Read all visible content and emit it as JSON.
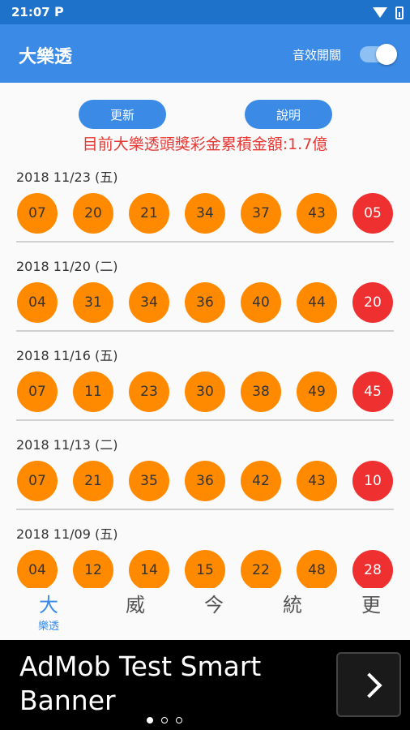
{
  "status_bar": {
    "time": "21:07",
    "notification_icon": "P"
  },
  "app_bar": {
    "title": "大樂透",
    "sound_label": "音效開關",
    "sound_on": true
  },
  "buttons": {
    "update": "更新",
    "help": "說明"
  },
  "jackpot_text": "目前大樂透頭獎彩金累積金額:1.7億",
  "draws": [
    {
      "date": "2018 11/23 (五)",
      "numbers": [
        "07",
        "20",
        "21",
        "34",
        "37",
        "43"
      ],
      "special": "05"
    },
    {
      "date": "2018 11/20 (二)",
      "numbers": [
        "04",
        "31",
        "34",
        "36",
        "40",
        "44"
      ],
      "special": "20"
    },
    {
      "date": "2018 11/16 (五)",
      "numbers": [
        "07",
        "11",
        "23",
        "30",
        "38",
        "49"
      ],
      "special": "45"
    },
    {
      "date": "2018 11/13 (二)",
      "numbers": [
        "07",
        "21",
        "35",
        "36",
        "42",
        "43"
      ],
      "special": "10"
    },
    {
      "date": "2018 11/09 (五)",
      "numbers": [
        "04",
        "12",
        "14",
        "15",
        "22",
        "48"
      ],
      "special": "28"
    }
  ],
  "bottom_nav": [
    {
      "glyph": "大",
      "label": "樂透",
      "active": true
    },
    {
      "glyph": "威",
      "label": "",
      "active": false
    },
    {
      "glyph": "今",
      "label": "",
      "active": false
    },
    {
      "glyph": "統",
      "label": "",
      "active": false
    },
    {
      "glyph": "更",
      "label": "",
      "active": false
    }
  ],
  "ad": {
    "text": "AdMob Test Smart Banner"
  },
  "colors": {
    "primary": "#3b8be6",
    "ball": "#ff8a00",
    "special_ball": "#ef3030",
    "jackpot": "#e53935"
  }
}
